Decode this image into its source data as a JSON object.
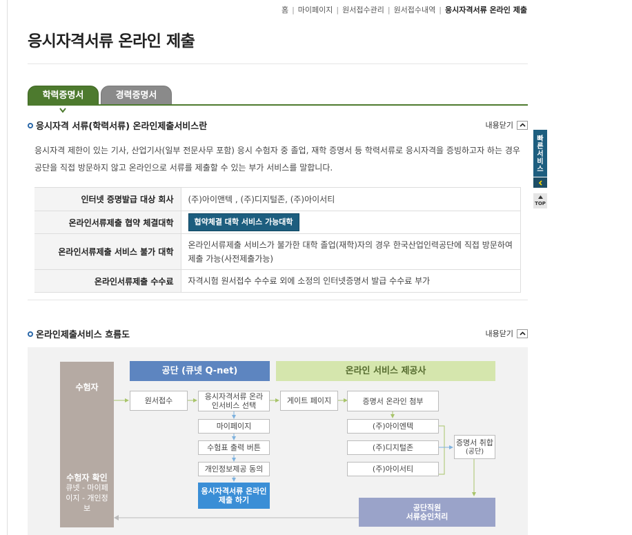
{
  "breadcrumb": {
    "home": "홈",
    "mypage": "마이페이지",
    "apply_mgmt": "원서접수관리",
    "apply_list": "원서접수내역",
    "current": "응시자격서류 온라인 제출"
  },
  "page_title": "응시자격서류 온라인 제출",
  "tabs": {
    "education": "학력증명서",
    "career": "경력증명서"
  },
  "section1": {
    "heading": "응시자격 서류(학력서류) 온라인제출서비스란",
    "collapse_label": "내용닫기",
    "description": "응시자격 제한이 있는 기사, 산업기사(일부 전문사무 포함) 응시 수험자 중 졸업, 재학 증명서 등 학력서류로 응시자격을 증빙하고자 하는 경우 공단을 직접 방문하지 않고 온라인으로 서류를 제출할 수 있는 부가 서비스를 말합니다.",
    "table": {
      "row1_label": "인터넷 증명발급 대상 회사",
      "row1_value": "(주)아이앤텍 , (주)디지털존, (주)아이서티",
      "row2_label": "온라인서류제출 협약 체결대학",
      "row2_button": "협약체결 대학 서비스 가능대학",
      "row3_label": "온라인서류제출 서비스 불가 대학",
      "row3_value": "온라인서류제출 서비스가 불가한 대학 졸업(재학)자의 경우 한국산업인력공단에 직접 방문하여 제출 가능(사전제출가능)",
      "row4_label": "온라인서류제출 수수료",
      "row4_value": "자격시험 원서접수 수수료 외에 소정의 인터넷증명서 발급 수수료 부가"
    }
  },
  "section2": {
    "heading": "온라인제출서비스 흐름도",
    "collapse_label": "내용닫기"
  },
  "flow": {
    "subject_label": "수험자",
    "subject_confirm": "수험자 확인",
    "subject_confirm_sub": "큐넷 - 마이페이지 - 개인정보",
    "gongdan_header": "공단  (큐넷 Q-net)",
    "provider_header": "온라인 서비스 제공사",
    "apply": "원서접수",
    "select_service": "응시자격서류 온라인서비스 선택",
    "mypage": "마이페이지",
    "print_ticket": "수험표 출력 버튼",
    "privacy_consent": "개인정보제공 동의",
    "submit_online": "응시자격서류 온라인 제출 하기",
    "gateway": "게이트 페이지",
    "attach_cert": "증명서 온라인 첨부",
    "company1": "(주)아이엔텍",
    "company2": "(주)디지털존",
    "company3": "(주)아이서티",
    "collect_cert": "증명서 취합",
    "collect_cert_sub": "(공단)",
    "staff_approval_1": "공단직원",
    "staff_approval_2": "서류승인처리"
  },
  "quick_menu": {
    "label": "빠른서비스",
    "top": "TOP"
  },
  "colors": {
    "tab_active": "#4d7a2e",
    "tab_inactive": "#8a8a8a",
    "accent_blue": "#1d5e7f",
    "flow_blue": "#5d85c0",
    "flow_green": "#d5e6ad"
  }
}
